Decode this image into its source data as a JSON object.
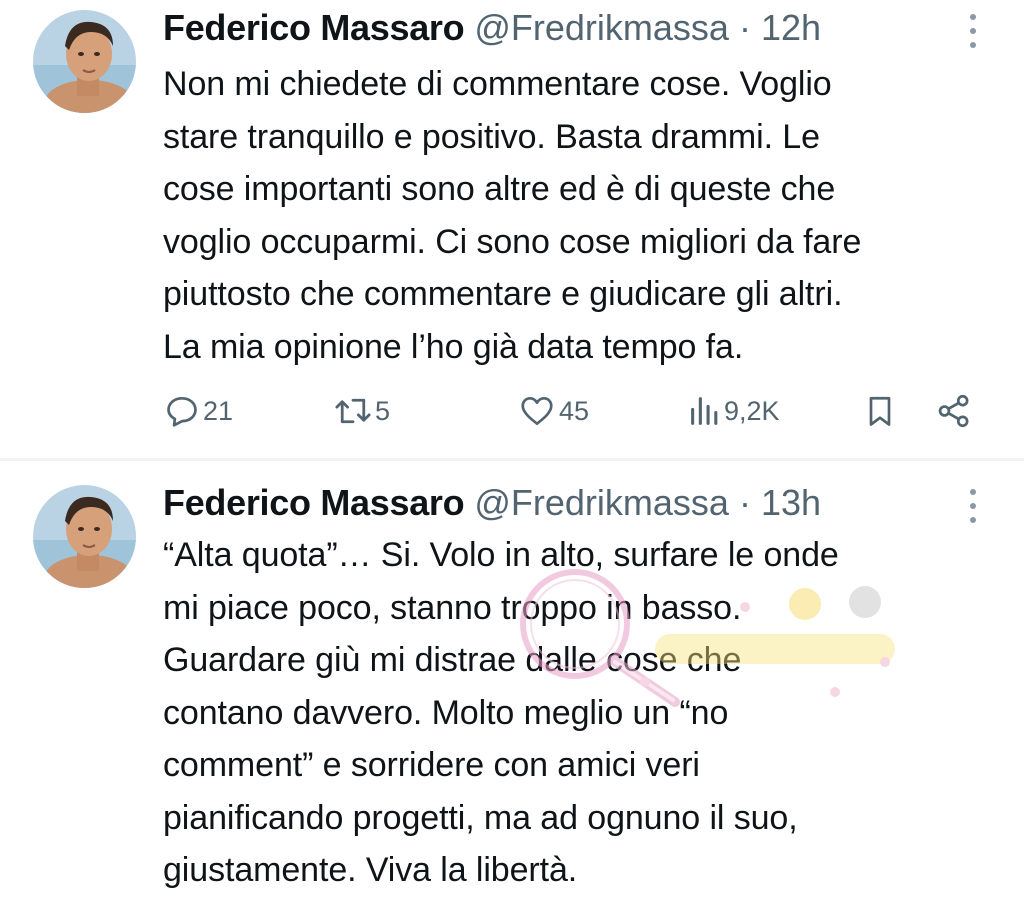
{
  "tweets": [
    {
      "author": {
        "name": "Federico Massaro",
        "handle": "@Fredrikmassa",
        "separator": "·",
        "time": "12h"
      },
      "text": "Non mi chiedete di commentare cose. Voglio\nstare tranquillo e positivo. Basta drammi. Le\ncose importanti sono altre ed è di queste che\nvoglio occuparmi. Ci sono cose migliori da fare\npiuttosto che commentare e giudicare gli altri.\nLa mia opinione l’ho già data tempo fa.",
      "stats": {
        "replies": "21",
        "retweets": "5",
        "likes": "45",
        "views": "9,2K"
      }
    },
    {
      "author": {
        "name": "Federico Massaro",
        "handle": "@Fredrikmassa",
        "separator": "·",
        "time": "13h"
      },
      "text": "“Alta quota”… Si. Volo in alto, surfare le onde\nmi piace poco, stanno troppo in basso.\nGuardare giù mi distrae dalle cose che\ncontano davvero. Molto meglio un “no\ncomment” e sorridere con amici veri\npianificando progetti, ma ad ognuno il suo,\ngiustamente. Viva la libertà."
    }
  ],
  "icons": {
    "reply": "comment-bubble-icon",
    "retweet": "retweet-arrows-icon",
    "like": "heart-outline-icon",
    "views": "bar-chart-icon",
    "bookmark": "bookmark-icon",
    "share": "share-nodes-icon",
    "more": "vertical-dots-icon"
  },
  "colors": {
    "text": "#0f1419",
    "muted": "#536471",
    "divider": "#eff3f4",
    "watermark_pink": "#e8a0c8"
  }
}
